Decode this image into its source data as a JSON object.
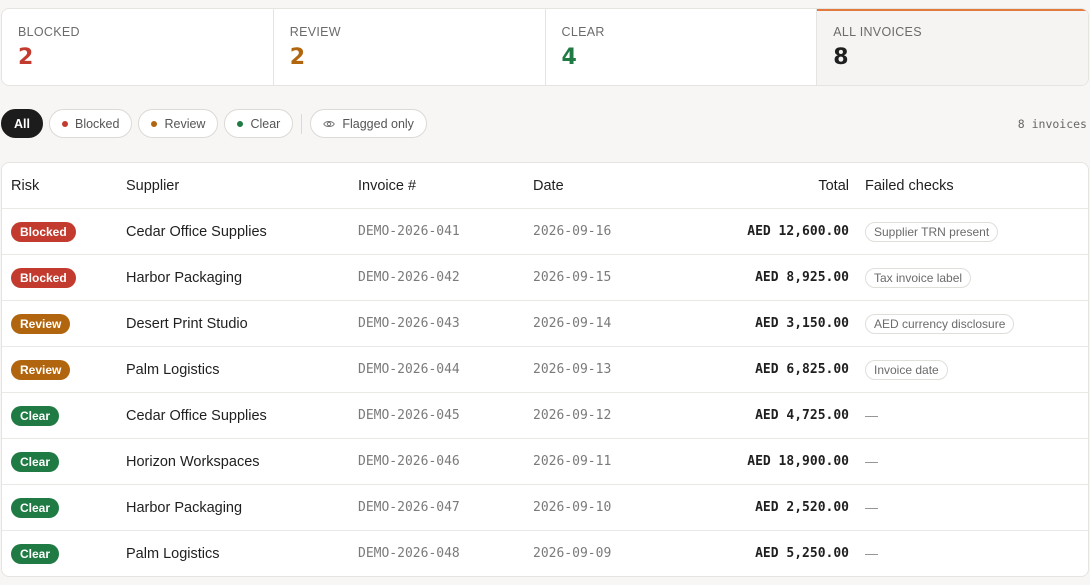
{
  "stats": [
    {
      "label": "BLOCKED",
      "value": "2",
      "color": "#c23b2e"
    },
    {
      "label": "REVIEW",
      "value": "2",
      "color": "#b1650f"
    },
    {
      "label": "CLEAR",
      "value": "4",
      "color": "#1f7a43"
    },
    {
      "label": "ALL INVOICES",
      "value": "8",
      "color": "#1f1f1f"
    }
  ],
  "filters": {
    "all": "All",
    "blocked": "Blocked",
    "review": "Review",
    "clear": "Clear",
    "flagged": "Flagged only",
    "count": "8 invoices"
  },
  "table": {
    "headers": {
      "risk": "Risk",
      "supplier": "Supplier",
      "invoice": "Invoice #",
      "date": "Date",
      "total": "Total",
      "failed": "Failed checks"
    },
    "rows": [
      {
        "risk": "Blocked",
        "supplier": "Cedar Office Supplies",
        "invoice": "DEMO-2026-041",
        "date": "2026-09-16",
        "total": "AED 12,600.00",
        "failed": "Supplier TRN present"
      },
      {
        "risk": "Blocked",
        "supplier": "Harbor Packaging",
        "invoice": "DEMO-2026-042",
        "date": "2026-09-15",
        "total": "AED 8,925.00",
        "failed": "Tax invoice label"
      },
      {
        "risk": "Review",
        "supplier": "Desert Print Studio",
        "invoice": "DEMO-2026-043",
        "date": "2026-09-14",
        "total": "AED 3,150.00",
        "failed": "AED currency disclosure"
      },
      {
        "risk": "Review",
        "supplier": "Palm Logistics",
        "invoice": "DEMO-2026-044",
        "date": "2026-09-13",
        "total": "AED 6,825.00",
        "failed": "Invoice date"
      },
      {
        "risk": "Clear",
        "supplier": "Cedar Office Supplies",
        "invoice": "DEMO-2026-045",
        "date": "2026-09-12",
        "total": "AED 4,725.00",
        "failed": "—"
      },
      {
        "risk": "Clear",
        "supplier": "Horizon Workspaces",
        "invoice": "DEMO-2026-046",
        "date": "2026-09-11",
        "total": "AED 18,900.00",
        "failed": "—"
      },
      {
        "risk": "Clear",
        "supplier": "Harbor Packaging",
        "invoice": "DEMO-2026-047",
        "date": "2026-09-10",
        "total": "AED 2,520.00",
        "failed": "—"
      },
      {
        "risk": "Clear",
        "supplier": "Palm Logistics",
        "invoice": "DEMO-2026-048",
        "date": "2026-09-09",
        "total": "AED 5,250.00",
        "failed": "—"
      }
    ]
  }
}
